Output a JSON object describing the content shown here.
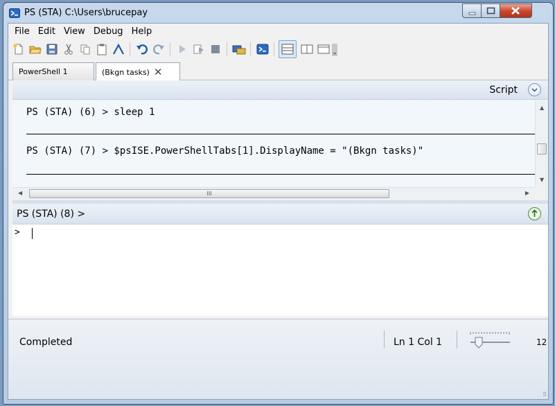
{
  "window": {
    "title": "PS (STA)  C:\\Users\\brucepay"
  },
  "menu": [
    "File",
    "Edit",
    "View",
    "Debug",
    "Help"
  ],
  "toolbar": {
    "buttons": [
      "new-file",
      "open-file",
      "save",
      "cut",
      "copy",
      "paste",
      "clear",
      "undo",
      "redo",
      "run",
      "run-selection",
      "stop",
      "new-remote-tab",
      "start-powershell",
      "show-script-top",
      "show-script-right",
      "show-script-maximized"
    ]
  },
  "tabs": [
    {
      "label": "PowerShell 1"
    },
    {
      "label": "(Bkgn tasks)",
      "close": "✕"
    }
  ],
  "script_pane": {
    "label": "Script"
  },
  "output": {
    "lines": [
      "PS (STA) (6) > sleep 1",
      "PS (STA) (7) > $psISE.PowerShellTabs[1].DisplayName = \"(Bkgn tasks)\""
    ]
  },
  "command_pane": {
    "prompt": "PS (STA) (8) >",
    "input_prompt": ">"
  },
  "status": {
    "text": "Completed",
    "position": "Ln 1  Col 1",
    "zoom": "12"
  },
  "colors": {
    "accent": "#2a6bc1",
    "close_button": "#c9452a",
    "run_green": "#2f7a1d"
  }
}
